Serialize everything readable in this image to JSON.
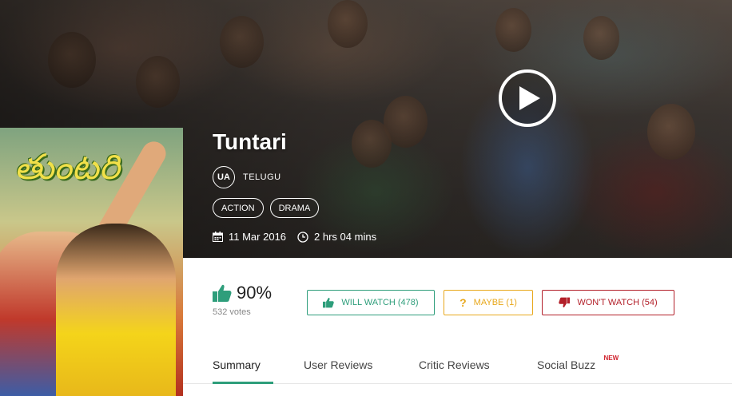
{
  "movie": {
    "title": "Tuntari",
    "certificate": "UA",
    "language": "TELUGU",
    "genres": [
      "ACTION",
      "DRAMA"
    ],
    "release_date": "11 Mar 2016",
    "duration": "2 hrs 04 mins",
    "poster_text": "తుంటరి"
  },
  "rating": {
    "percent": "90%",
    "votes": "532 votes"
  },
  "actions": {
    "will_watch": "WILL WATCH (478)",
    "maybe": "MAYBE (1)",
    "wont_watch": "WON'T WATCH (54)"
  },
  "tabs": [
    {
      "label": "Summary"
    },
    {
      "label": "User Reviews"
    },
    {
      "label": "Critic Reviews"
    },
    {
      "label": "Social Buzz"
    }
  ],
  "badges": {
    "new": "NEW"
  },
  "colors": {
    "green": "#2e9e7b",
    "amber": "#e8a81c",
    "red": "#b3202a",
    "new_badge": "#d0232e"
  },
  "icons": {
    "play": "play-icon",
    "calendar": "calendar-icon",
    "clock": "clock-icon",
    "thumbs_up": "thumbs-up-icon",
    "thumbs_down": "thumbs-down-icon",
    "question": "question-icon"
  }
}
